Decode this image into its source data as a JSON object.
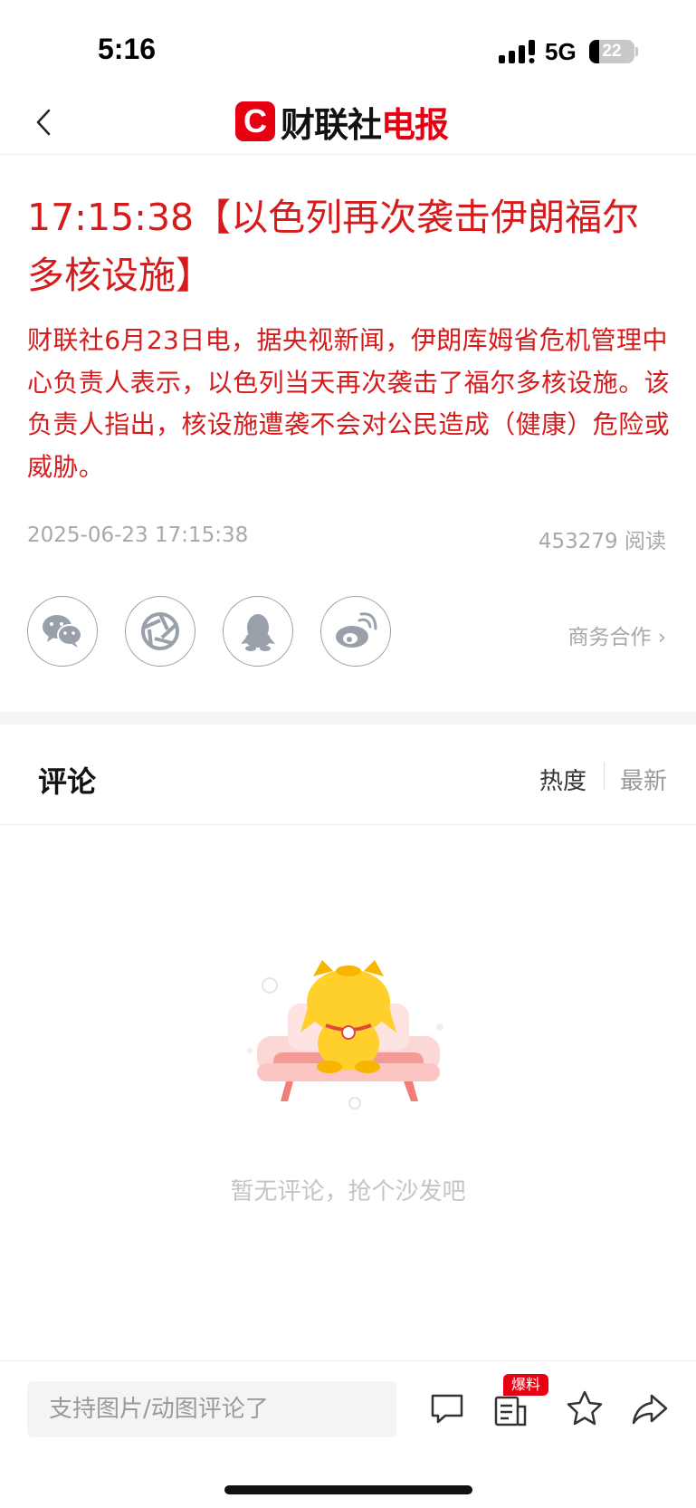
{
  "status_bar": {
    "time": "5:16",
    "network": "5G",
    "battery_level": "22",
    "battery_fraction": 0.22
  },
  "navbar": {
    "logo_letter": "C",
    "logo_name_black": "财联社",
    "logo_name_red": "电报"
  },
  "article": {
    "headline": "17:15:38【以色列再次袭击伊朗福尔多核设施】",
    "body": "财联社6月23日电，据央视新闻，伊朗库姆省危机管理中心负责人表示，以色列当天再次袭击了福尔多核设施。该负责人指出，核设施遭袭不会对公民造成（健康）危险或威胁。",
    "date": "2025-06-23 17:15:38",
    "reads": "453279 阅读",
    "accent_color": "#d51b1b"
  },
  "share": {
    "icons": [
      "wechat-icon",
      "moments-icon",
      "qq-icon",
      "weibo-icon"
    ],
    "business_link": "商务合作 ›"
  },
  "comments": {
    "title": "评论",
    "sort_hot": "热度",
    "sort_new": "最新",
    "empty_text": "暂无评论，抢个沙发吧"
  },
  "bottom_bar": {
    "input_placeholder": "支持图片/动图评论了",
    "badge": "爆料",
    "icons": [
      "comment-icon",
      "tipoff-icon",
      "star-icon",
      "share-icon"
    ]
  }
}
